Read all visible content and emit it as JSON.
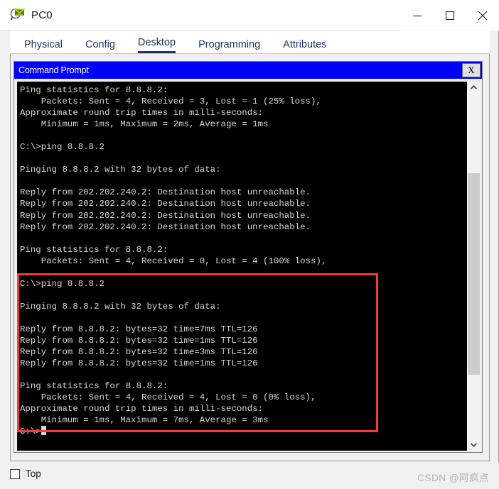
{
  "window": {
    "title": "PC0",
    "icon": "packet-tracer-pc-icon",
    "controls": {
      "minimize": "minimize-icon",
      "maximize": "maximize-icon",
      "close": "close-icon"
    }
  },
  "tabs": [
    {
      "label": "Physical",
      "active": false
    },
    {
      "label": "Config",
      "active": false
    },
    {
      "label": "Desktop",
      "active": true
    },
    {
      "label": "Programming",
      "active": false
    },
    {
      "label": "Attributes",
      "active": false
    }
  ],
  "command_prompt": {
    "title": "Command Prompt",
    "close_label": "X",
    "scrollbar": {
      "up_icon": "chevron-up-icon",
      "down_icon": "chevron-down-icon"
    },
    "terminal_text": "Ping statistics for 8.8.8.2:\n    Packets: Sent = 4, Received = 3, Lost = 1 (25% loss),\nApproximate round trip times in milli-seconds:\n    Minimum = 1ms, Maximum = 2ms, Average = 1ms\n\nC:\\>ping 8.8.8.2\n\nPinging 8.8.8.2 with 32 bytes of data:\n\nReply from 202.202.240.2: Destination host unreachable.\nReply from 202.202.240.2: Destination host unreachable.\nReply from 202.202.240.2: Destination host unreachable.\nReply from 202.202.240.2: Destination host unreachable.\n\nPing statistics for 8.8.8.2:\n    Packets: Sent = 4, Received = 0, Lost = 4 (100% loss),\n\nC:\\>ping 8.8.8.2\n\nPinging 8.8.8.2 with 32 bytes of data:\n\nReply from 8.8.8.2: bytes=32 time=7ms TTL=126\nReply from 8.8.8.2: bytes=32 time=1ms TTL=126\nReply from 8.8.8.2: bytes=32 time=3ms TTL=126\nReply from 8.8.8.2: bytes=32 time=1ms TTL=126\n\nPing statistics for 8.8.8.2:\n    Packets: Sent = 4, Received = 4, Lost = 0 (0% loss),\nApproximate round trip times in milli-seconds:\n    Minimum = 1ms, Maximum = 7ms, Average = 3ms\n",
    "prompt": "C:\\>",
    "annotation_color": "#f33b3b"
  },
  "bottom": {
    "top_checkbox_label": "Top",
    "top_checkbox_checked": false,
    "watermark": "CSDN @阿疯点"
  }
}
